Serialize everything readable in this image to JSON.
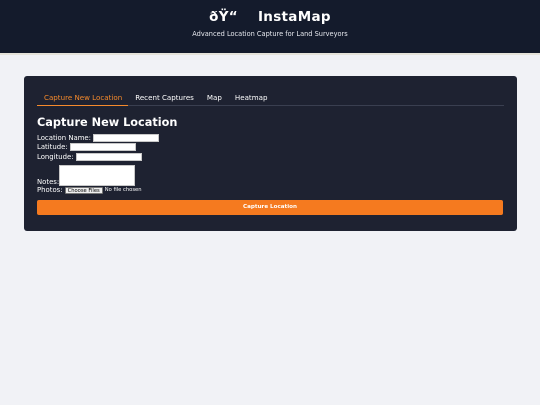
{
  "header": {
    "title_glyph": "ðŸ“",
    "title": "InstaMap",
    "subtitle": "Advanced Location Capture for Land Surveyors"
  },
  "tabs": [
    {
      "label": "Capture New Location",
      "active": true
    },
    {
      "label": "Recent Captures",
      "active": false
    },
    {
      "label": "Map",
      "active": false
    },
    {
      "label": "Heatmap",
      "active": false
    }
  ],
  "form": {
    "heading": "Capture New Location",
    "location_name_label": "Location Name:",
    "location_name_value": "",
    "latitude_label": "Latitude:",
    "latitude_value": "",
    "longitude_label": "Longitude:",
    "longitude_value": "",
    "notes_label": "Notes:",
    "notes_value": "",
    "photos_label": "Photos:",
    "file_button_label": "Choose Files",
    "file_status": "No file chosen",
    "submit_label": "Capture Location"
  },
  "colors": {
    "header_bg": "#141b2c",
    "panel_bg": "#1e2231",
    "accent": "#f57a1f",
    "page_bg": "#f1f2f6"
  }
}
